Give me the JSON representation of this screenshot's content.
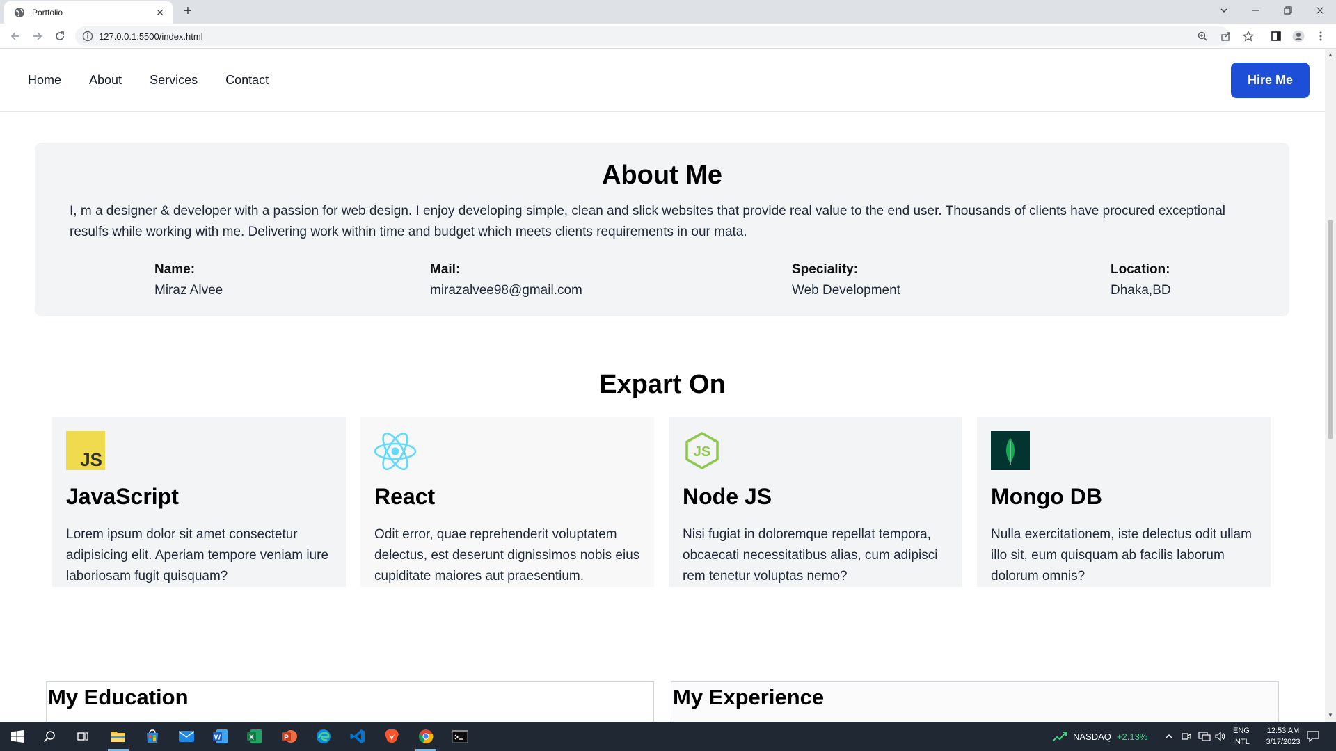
{
  "browser": {
    "tab_title": "Portfolio",
    "url": "127.0.0.1:5500/index.html"
  },
  "nav": {
    "links": [
      "Home",
      "About",
      "Services",
      "Contact"
    ],
    "hire_button": "Hire Me"
  },
  "about": {
    "title": "About Me",
    "description": "I, m a designer & developer with a passion for web design. I enjoy developing simple, clean and slick websites that provide real value to the end user. Thousands of clients have procured exceptional resulfs while working with me. Delivering work within time and budget which meets clients requirements in our mata.",
    "info": [
      {
        "label": "Name:",
        "value": "Miraz Alvee"
      },
      {
        "label": "Mail:",
        "value": "mirazalvee98@gmail.com"
      },
      {
        "label": "Speciality:",
        "value": "Web Development"
      },
      {
        "label": "Location:",
        "value": "Dhaka,BD"
      }
    ]
  },
  "expertise": {
    "title": "Expart On",
    "cards": [
      {
        "icon": "javascript-icon",
        "title": "JavaScript",
        "text": "Lorem ipsum dolor sit amet consectetur adipisicing elit. Aperiam tempore veniam iure laboriosam fugit quisquam?"
      },
      {
        "icon": "react-icon",
        "title": "React",
        "text": "Odit error, quae reprehenderit voluptatem delectus, est deserunt dignissimos nobis eius cupiditate maiores aut praesentium."
      },
      {
        "icon": "nodejs-icon",
        "title": "Node JS",
        "text": "Nisi fugiat in doloremque repellat tempora, obcaecati necessitatibus alias, cum adipisci rem tenetur voluptas nemo?"
      },
      {
        "icon": "mongodb-icon",
        "title": "Mongo DB",
        "text": "Nulla exercitationem, iste delectus odit ullam illo sit, eum quisquam ab facilis laborum dolorum omnis?"
      }
    ]
  },
  "sections": {
    "education": "My Education",
    "experience": "My Experience"
  },
  "taskbar": {
    "stock_name": "NASDAQ",
    "stock_change": "+2.13%",
    "lang_top": "ENG",
    "lang_bottom": "INTL",
    "time": "12:53 AM",
    "date": "3/17/2023"
  },
  "colors": {
    "accent": "#1d4ed8",
    "card_bg": "#f3f4f6",
    "stock_up": "#3ddc84"
  }
}
